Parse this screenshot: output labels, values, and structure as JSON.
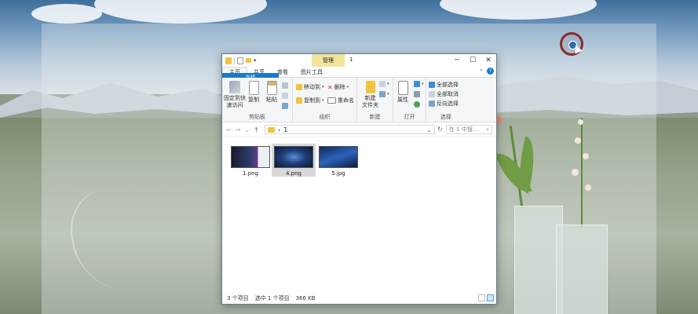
{
  "window": {
    "title": "1",
    "context_tab": "管理",
    "controls": {
      "minimize": "─",
      "maximize": "☐",
      "close": "✕"
    },
    "quick_access_dropdown": "▾"
  },
  "menu_tabs": [
    {
      "label": "文件"
    },
    {
      "label": "主页"
    },
    {
      "label": "共享"
    },
    {
      "label": "查看"
    },
    {
      "label": "图片工具"
    }
  ],
  "ribbon_collapse": "⌃",
  "help": "?",
  "ribbon": {
    "clipboard": {
      "group_label": "剪贴板",
      "pin_label_1": "固定到快",
      "pin_label_2": "速访问",
      "copy": "复制",
      "paste": "粘贴"
    },
    "organize": {
      "group_label": "组织",
      "move_to": "移动到",
      "copy_to": "复制到",
      "delete": "删除",
      "rename": "重命名"
    },
    "new": {
      "group_label": "新建",
      "new_folder_1": "新建",
      "new_folder_2": "文件夹"
    },
    "open": {
      "group_label": "打开",
      "properties": "属性"
    },
    "select": {
      "group_label": "选择",
      "select_all": "全部选择",
      "select_none": "全部取消",
      "invert": "反向选择"
    }
  },
  "address": {
    "back": "←",
    "forward": "→",
    "recent": "⌄",
    "up": "↑",
    "separator": "›",
    "path": "1",
    "path_dropdown": "⌄",
    "refresh": "↻",
    "search_placeholder": "在 1 中搜..."
  },
  "files": [
    {
      "name": "1.png",
      "selected": false
    },
    {
      "name": "4.png",
      "selected": true
    },
    {
      "name": "5.jpg",
      "selected": false
    }
  ],
  "status": {
    "count": "3 个项目",
    "selected": "选中 1 个项目",
    "size": "366 KB"
  },
  "colors": {
    "file_tab": "#1979ca",
    "context_tab": "#f3e49a",
    "folder": "#f2c33b",
    "selection": "#d9d9d9",
    "cursor_ring": "#8a2a2a"
  }
}
